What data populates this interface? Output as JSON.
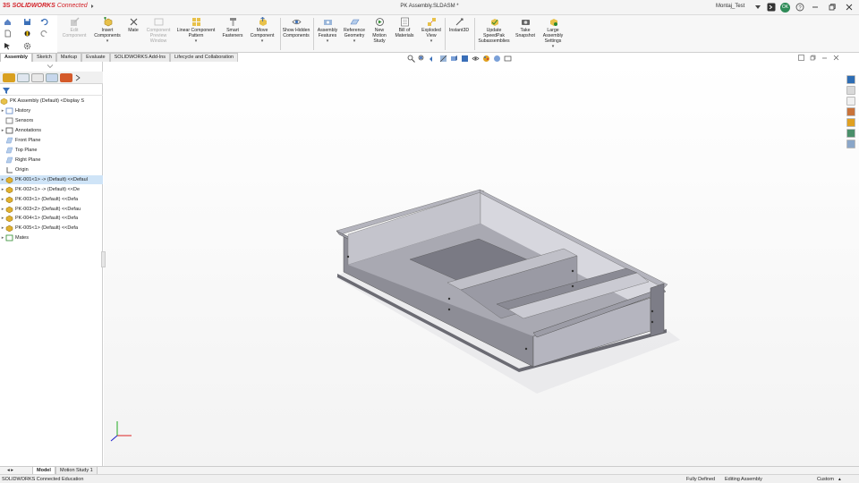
{
  "app": {
    "brand_ds": "3S",
    "brand_name": "SOLIDWORKS",
    "brand_suffix": "Connected",
    "window_title": "PK Assembly.SLDASM *",
    "username": "Montaj_Test",
    "avatar_initials": "OK",
    "accent": "#d32027"
  },
  "commands": [
    {
      "label": "Edit Component",
      "enabled": false
    },
    {
      "label": "Insert Components",
      "enabled": true
    },
    {
      "label": "Mate",
      "enabled": true
    },
    {
      "label": "Component Preview Window",
      "enabled": false
    },
    {
      "label": "Linear Component Pattern",
      "enabled": true
    },
    {
      "label": "Smart Fasteners",
      "enabled": true
    },
    {
      "label": "Move Component",
      "enabled": true
    },
    {
      "label": "Show Hidden Components",
      "enabled": true
    },
    {
      "label": "Assembly Features",
      "enabled": true
    },
    {
      "label": "Reference Geometry",
      "enabled": true
    },
    {
      "label": "New Motion Study",
      "enabled": true
    },
    {
      "label": "Bill of Materials",
      "enabled": true
    },
    {
      "label": "Exploded View",
      "enabled": true
    },
    {
      "label": "Instant3D",
      "enabled": true
    },
    {
      "label": "Update SpeedPak Subassemblies",
      "enabled": true
    },
    {
      "label": "Take Snapshot",
      "enabled": true
    },
    {
      "label": "Large Assembly Settings",
      "enabled": true
    }
  ],
  "tabs": [
    "Assembly",
    "Sketch",
    "Markup",
    "Evaluate",
    "SOLIDWORKS Add-Ins",
    "Lifecycle and Collaboration"
  ],
  "tree": {
    "root": "PK Assembly  (Default) <Display S",
    "items": [
      {
        "label": "History",
        "icon": "history-icon",
        "expand": "▸"
      },
      {
        "label": "Sensors",
        "icon": "sensors-icon",
        "expand": ""
      },
      {
        "label": "Annotations",
        "icon": "annotations-icon",
        "expand": "▸"
      },
      {
        "label": "Front Plane",
        "icon": "plane-icon",
        "expand": ""
      },
      {
        "label": "Top Plane",
        "icon": "plane-icon",
        "expand": ""
      },
      {
        "label": "Right Plane",
        "icon": "plane-icon",
        "expand": ""
      },
      {
        "label": "Origin",
        "icon": "origin-icon",
        "expand": ""
      },
      {
        "label": "PK-001<1> -> (Default) <<Defaul",
        "icon": "part-icon",
        "expand": "▸"
      },
      {
        "label": "PK-002<1> -> (Default) <<De",
        "icon": "part-icon",
        "expand": "▸"
      },
      {
        "label": "PK-003<1> (Default) <<Defa",
        "icon": "part-icon",
        "expand": "▸"
      },
      {
        "label": "PK-003<2> (Default) <<Defau",
        "icon": "part-icon",
        "expand": "▸"
      },
      {
        "label": "PK-004<1> (Default) <<Defa",
        "icon": "part-icon",
        "expand": "▸"
      },
      {
        "label": "PK-005<1> (Default) <<Defa",
        "icon": "part-icon",
        "expand": "▸"
      },
      {
        "label": "Mates",
        "icon": "mates-icon",
        "expand": "▸"
      }
    ]
  },
  "bottom_tabs": [
    "Model",
    "Motion Study 1"
  ],
  "status": {
    "left": "SOLIDWORKS Connected Education",
    "state": "Fully Defined",
    "mode": "Editing Assembly",
    "units": "Custom"
  }
}
